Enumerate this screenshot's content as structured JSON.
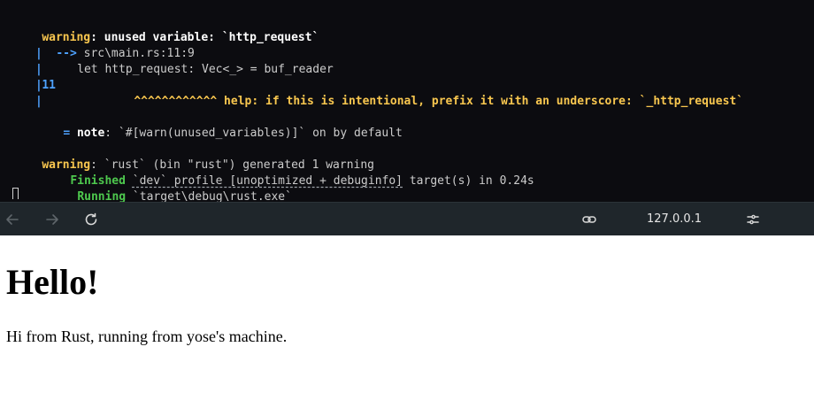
{
  "terminal": {
    "warning1": {
      "keyword": "warning",
      "message": ": unused variable: `http_request`"
    },
    "location": {
      "arrow": "-->",
      "path": " src\\main.rs:11:9"
    },
    "gutter_bar": "|",
    "code_line": {
      "number": "11",
      "bar": "|",
      "code": "     let http_request: Vec<_> = buf_reader"
    },
    "help_line": {
      "carets": "^^^^^^^^^^^^",
      "help_text": " help: if this is intentional, prefix it with an underscore: `_http_request`"
    },
    "note_line": {
      "equals": "=",
      "label": " note",
      "text": ": `#[warn(unused_variables)]` on by default"
    },
    "warning2": {
      "keyword": "warning",
      "text": ": `rust` (bin \"rust\") generated 1 warning"
    },
    "finished_line": {
      "label": "Finished",
      "profile_part": "`dev` profile [unoptimized + debuginfo]",
      "rest": " target(s) in 0.24s"
    },
    "running_line": {
      "label": "Running",
      "text": " `target\\debug\\rust.exe`"
    }
  },
  "browser": {
    "url": "127.0.0.1",
    "icons": {
      "back": "arrow-left-icon",
      "forward": "arrow-right-icon",
      "reload": "reload-icon",
      "link": "link-icon",
      "settings": "tune-icon"
    }
  },
  "page": {
    "heading": "Hello!",
    "paragraph": "Hi from Rust, running from yose's machine."
  }
}
